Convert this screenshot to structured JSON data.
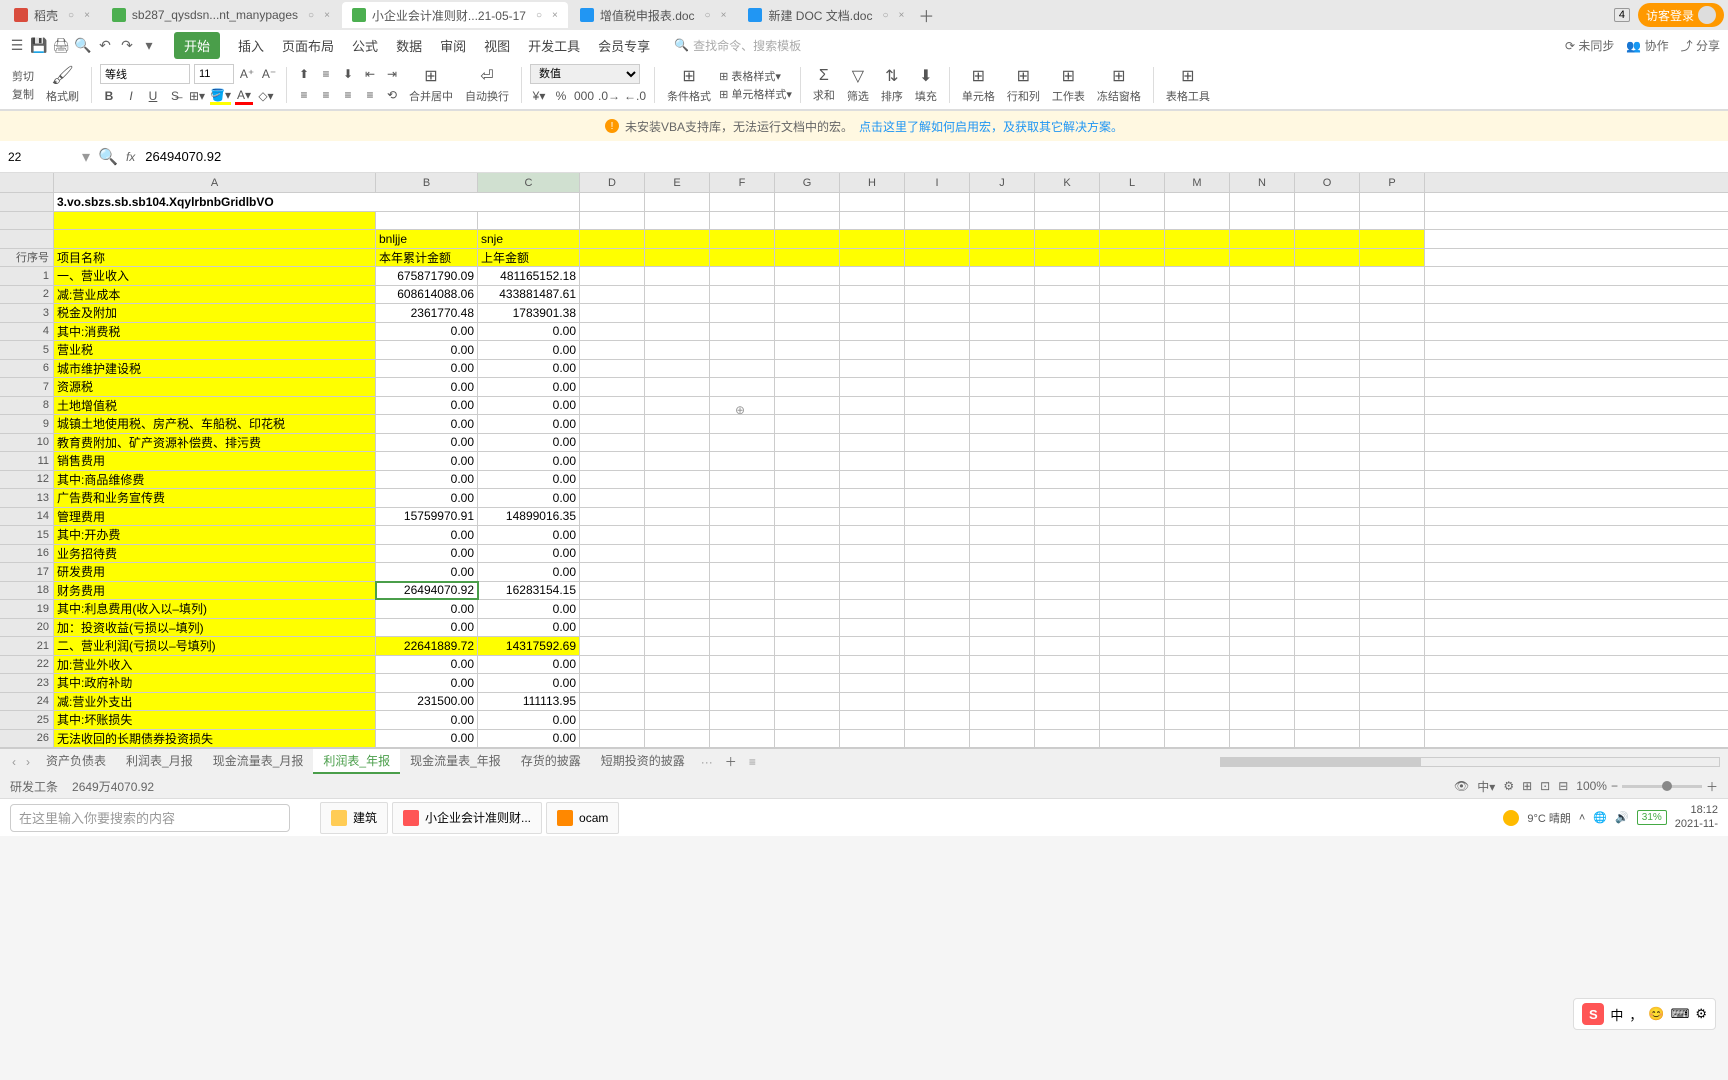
{
  "tabs": [
    {
      "icon": "d",
      "label": "稻壳"
    },
    {
      "icon": "s",
      "label": "sb287_qysdsn...nt_manypages"
    },
    {
      "icon": "s",
      "label": "小企业会计准则财...21-05-17",
      "active": true
    },
    {
      "icon": "w",
      "label": "增值税申报表.doc"
    },
    {
      "icon": "w",
      "label": "新建 DOC 文档.doc"
    }
  ],
  "tab_badge": "4",
  "login_label": "访客登录",
  "menu": {
    "tabs": [
      "开始",
      "插入",
      "页面布局",
      "公式",
      "数据",
      "审阅",
      "视图",
      "开发工具",
      "会员专享"
    ],
    "search_placeholder": "查找命令、搜索模板",
    "right": {
      "sync": "未同步",
      "collab": "协作",
      "share": "分享"
    }
  },
  "toolbar": {
    "cut": "剪切",
    "copy": "复制",
    "brush": "格式刷",
    "font": "等线",
    "size": "11",
    "merge": "合并居中",
    "wrap": "自动换行",
    "number_format": "数值",
    "cond_format": "条件格式",
    "cell_style": "单元格样式",
    "table_style": "表格样式",
    "sum": "求和",
    "filter": "筛选",
    "sort": "排序",
    "fill": "填充",
    "cells": "单元格",
    "rowcol": "行和列",
    "sheet": "工作表",
    "freeze": "冻结窗格",
    "tools": "表格工具"
  },
  "warning": {
    "text": "未安装VBA支持库，无法运行文档中的宏。",
    "link": "点击这里了解如何启用宏，及获取其它解决方案。"
  },
  "formula": {
    "cell_ref": "22",
    "value": "26494070.92"
  },
  "cols": [
    "A",
    "B",
    "C",
    "D",
    "E",
    "F",
    "G",
    "H",
    "I",
    "J",
    "K",
    "L",
    "M",
    "N",
    "O",
    "P"
  ],
  "header_text": "3.vo.sbzs.sb.sb104.XqylrbnbGridlbVO",
  "col_hdrs": {
    "c1": "bnljje",
    "c2": "本年累计金额",
    "d1": "snje",
    "d2": "上年金额"
  },
  "row_hdr": {
    "a": "行序号",
    "b": "项目名称"
  },
  "rows": [
    {
      "n": 1,
      "name": "一、营业收入",
      "c": "675871790.09",
      "d": "481165152.18"
    },
    {
      "n": 2,
      "name": "减:营业成本",
      "c": "608614088.06",
      "d": "433881487.61"
    },
    {
      "n": 3,
      "name": "税金及附加",
      "c": "2361770.48",
      "d": "1783901.38"
    },
    {
      "n": 4,
      "name": "其中:消费税",
      "c": "0.00",
      "d": "0.00"
    },
    {
      "n": 5,
      "name": "营业税",
      "c": "0.00",
      "d": "0.00"
    },
    {
      "n": 6,
      "name": "城市维护建设税",
      "c": "0.00",
      "d": "0.00"
    },
    {
      "n": 7,
      "name": "资源税",
      "c": "0.00",
      "d": "0.00"
    },
    {
      "n": 8,
      "name": "土地增值税",
      "c": "0.00",
      "d": "0.00"
    },
    {
      "n": 9,
      "name": "城镇土地使用税、房产税、车船税、印花税",
      "c": "0.00",
      "d": "0.00"
    },
    {
      "n": 10,
      "name": "教育费附加、矿产资源补偿费、排污费",
      "c": "0.00",
      "d": "0.00"
    },
    {
      "n": 11,
      "name": "销售费用",
      "c": "0.00",
      "d": "0.00"
    },
    {
      "n": 12,
      "name": "其中:商品维修费",
      "c": "0.00",
      "d": "0.00"
    },
    {
      "n": 13,
      "name": "广告费和业务宣传费",
      "c": "0.00",
      "d": "0.00"
    },
    {
      "n": 14,
      "name": "管理费用",
      "c": "15759970.91",
      "d": "14899016.35"
    },
    {
      "n": 15,
      "name": "其中:开办费",
      "c": "0.00",
      "d": "0.00"
    },
    {
      "n": 16,
      "name": "业务招待费",
      "c": "0.00",
      "d": "0.00"
    },
    {
      "n": 17,
      "name": "研发费用",
      "c": "0.00",
      "d": "0.00"
    },
    {
      "n": 18,
      "name": "财务费用",
      "c": "26494070.92",
      "d": "16283154.15",
      "selected": true
    },
    {
      "n": 19,
      "name": "其中:利息费用(收入以–填列)",
      "c": "0.00",
      "d": "0.00"
    },
    {
      "n": 20,
      "name": "加：投资收益(亏损以–填列)",
      "c": "0.00",
      "d": "0.00"
    },
    {
      "n": 21,
      "name": "二、营业利润(亏损以–号填列)",
      "c": "22641889.72",
      "d": "14317592.69",
      "hl": true
    },
    {
      "n": 22,
      "name": "加:营业外收入",
      "c": "0.00",
      "d": "0.00"
    },
    {
      "n": 23,
      "name": "其中:政府补助",
      "c": "0.00",
      "d": "0.00"
    },
    {
      "n": 24,
      "name": "减:营业外支出",
      "c": "231500.00",
      "d": "111113.95"
    },
    {
      "n": 25,
      "name": "其中:坏账损失",
      "c": "0.00",
      "d": "0.00"
    },
    {
      "n": 26,
      "name": "无法收回的长期债券投资损失",
      "c": "0.00",
      "d": "0.00"
    }
  ],
  "sheets": [
    "资产负债表",
    "利润表_月报",
    "现金流量表_月报",
    "利润表_年报",
    "现金流量表_年报",
    "存货的披露",
    "短期投资的披露"
  ],
  "active_sheet": 3,
  "status": {
    "left1": "研发工条",
    "left2": "2649万4070.92",
    "zoom": "100%"
  },
  "search_placeholder": "在这里输入你要搜索的内容",
  "taskbar": {
    "items": [
      {
        "label": "建筑",
        "color": "#fc5"
      },
      {
        "label": "小企业会计准则财...",
        "color": "#f55"
      },
      {
        "label": "ocam",
        "color": "#f80"
      }
    ],
    "weather": "9°C 晴朗",
    "battery": "31%",
    "time": "18:12",
    "date": "2021-11-"
  },
  "ime": {
    "lang": "中"
  }
}
